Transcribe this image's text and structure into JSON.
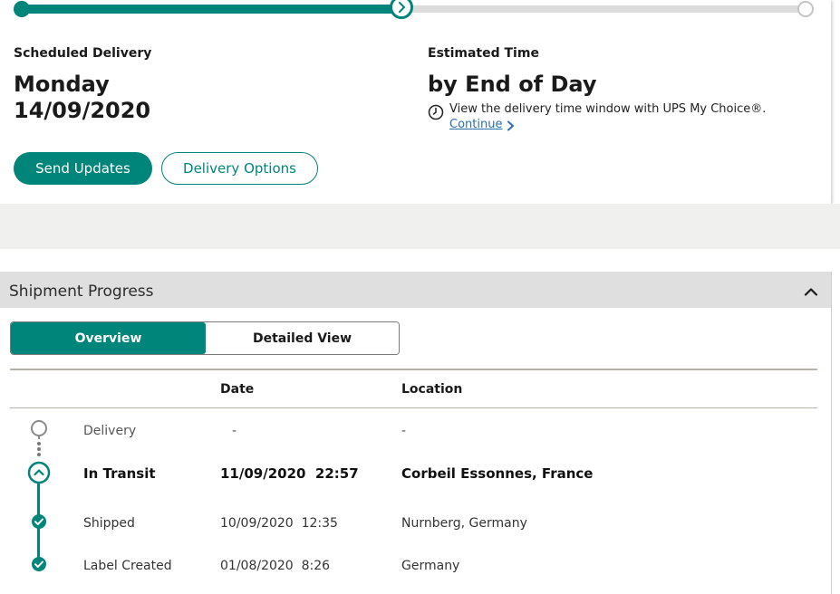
{
  "colors": {
    "accent": "#00857a",
    "link": "#2a6fb0",
    "track": "#dcdcdc"
  },
  "delivery": {
    "progress": 0.5,
    "scheduled_label": "Scheduled Delivery",
    "scheduled_day": "Monday",
    "scheduled_date": "14/09/2020",
    "estimated_label": "Estimated Time",
    "estimated_value": "by End of Day",
    "time_note": "View the delivery time window with UPS My Choice®.",
    "continue_label": "Continue",
    "send_updates_label": "Send Updates",
    "delivery_options_label": "Delivery Options"
  },
  "shipment": {
    "title": "Shipment Progress",
    "tabs": [
      {
        "label": "Overview",
        "active": true
      },
      {
        "label": "Detailed View",
        "active": false
      }
    ],
    "columns": {
      "date": "Date",
      "location": "Location"
    },
    "rows": [
      {
        "status": "Delivery",
        "date": "-",
        "location": "-",
        "icon": "empty-circle-icon"
      },
      {
        "status": "In Transit",
        "date": "11/09/2020  22:57",
        "location": "Corbeil Essonnes, France",
        "icon": "chevron-up-circle-icon"
      },
      {
        "status": "Shipped",
        "date": "10/09/2020  12:35",
        "location": "Nurnberg, Germany",
        "icon": "check-circle-icon"
      },
      {
        "status": "Label Created",
        "date": "01/08/2020  8:26",
        "location": "Germany",
        "icon": "check-circle-icon"
      }
    ]
  }
}
